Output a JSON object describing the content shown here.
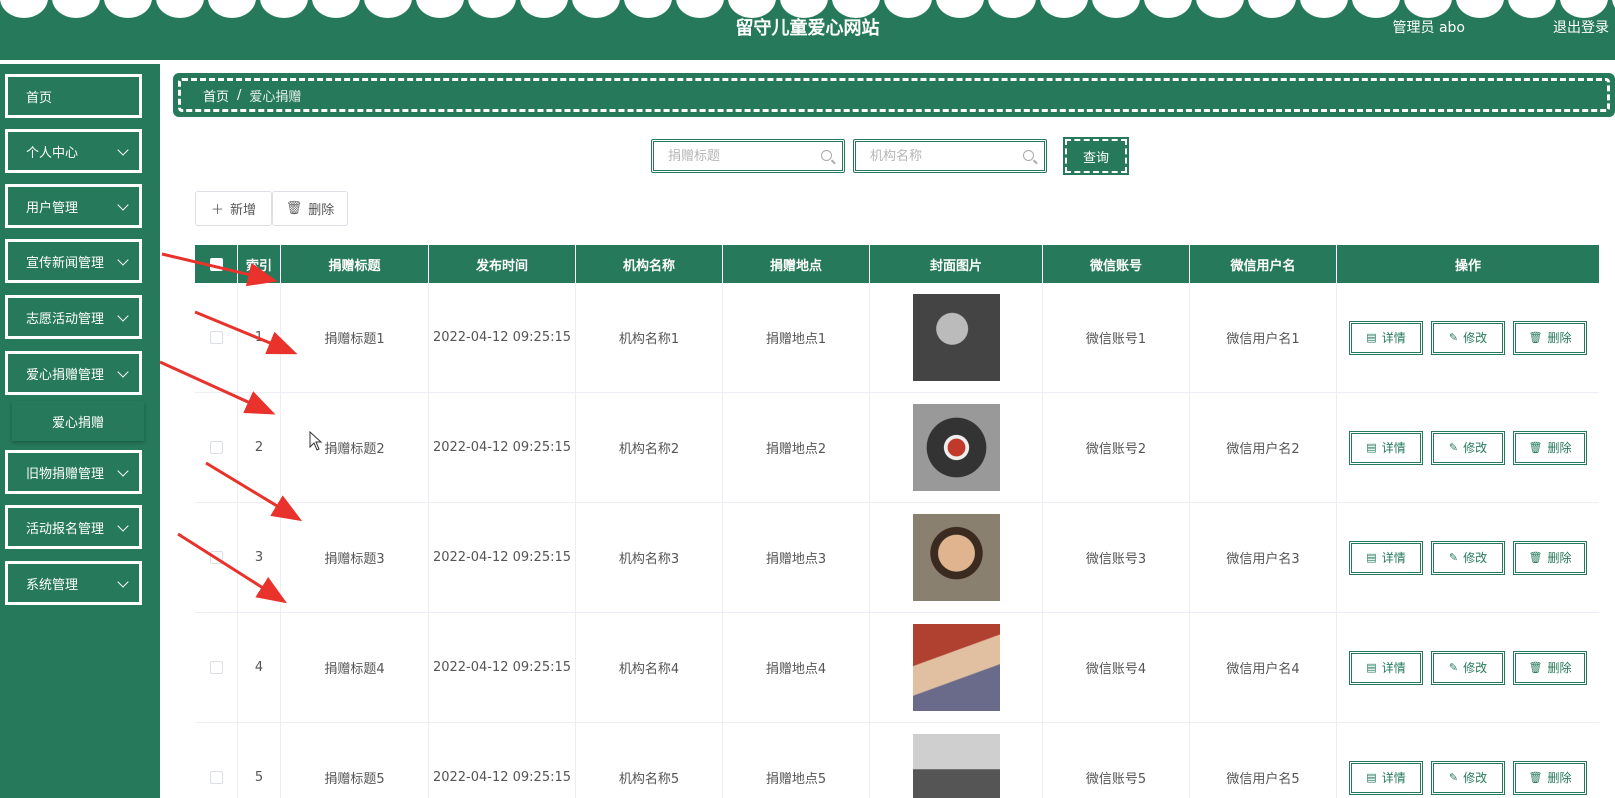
{
  "header": {
    "title": "留守儿童爱心网站",
    "admin": "管理员 abo",
    "logout": "退出登录"
  },
  "sidebar": {
    "items": [
      {
        "label": "首页",
        "has_children": false
      },
      {
        "label": "个人中心",
        "has_children": true
      },
      {
        "label": "用户管理",
        "has_children": true
      },
      {
        "label": "宣传新闻管理",
        "has_children": true
      },
      {
        "label": "志愿活动管理",
        "has_children": true
      },
      {
        "label": "爱心捐赠管理",
        "has_children": true
      },
      {
        "label": "旧物捐赠管理",
        "has_children": true
      },
      {
        "label": "活动报名管理",
        "has_children": true
      },
      {
        "label": "系统管理",
        "has_children": true
      }
    ],
    "submenu": {
      "label": "爱心捐赠"
    }
  },
  "breadcrumb": {
    "home": "首页",
    "sep": "/",
    "current": "爱心捐赠"
  },
  "search": {
    "title_placeholder": "捐赠标题",
    "org_placeholder": "机构名称",
    "query": "查询"
  },
  "toolbar": {
    "add": "新增",
    "delete": "删除"
  },
  "table": {
    "headers": [
      "索引",
      "捐赠标题",
      "发布时间",
      "机构名称",
      "捐赠地点",
      "封面图片",
      "微信账号",
      "微信用户名",
      "操作"
    ],
    "actions": {
      "detail": "详情",
      "edit": "修改",
      "delete": "删除"
    },
    "rows": [
      {
        "index": "1",
        "title": "捐赠标题1",
        "time": "2022-04-12 09:25:15",
        "org": "机构名称1",
        "place": "捐赠地点1",
        "wx": "微信账号1",
        "wxname": "微信用户名1"
      },
      {
        "index": "2",
        "title": "捐赠标题2",
        "time": "2022-04-12 09:25:15",
        "org": "机构名称2",
        "place": "捐赠地点2",
        "wx": "微信账号2",
        "wxname": "微信用户名2"
      },
      {
        "index": "3",
        "title": "捐赠标题3",
        "time": "2022-04-12 09:25:15",
        "org": "机构名称3",
        "place": "捐赠地点3",
        "wx": "微信账号3",
        "wxname": "微信用户名3"
      },
      {
        "index": "4",
        "title": "捐赠标题4",
        "time": "2022-04-12 09:25:15",
        "org": "机构名称4",
        "place": "捐赠地点4",
        "wx": "微信账号4",
        "wxname": "微信用户名4"
      },
      {
        "index": "5",
        "title": "捐赠标题5",
        "time": "2022-04-12 09:25:15",
        "org": "机构名称5",
        "place": "捐赠地点5",
        "wx": "微信账号5",
        "wxname": "微信用户名5"
      }
    ]
  },
  "colors": {
    "primary": "#267a5b",
    "annotation": "#e8322b"
  }
}
